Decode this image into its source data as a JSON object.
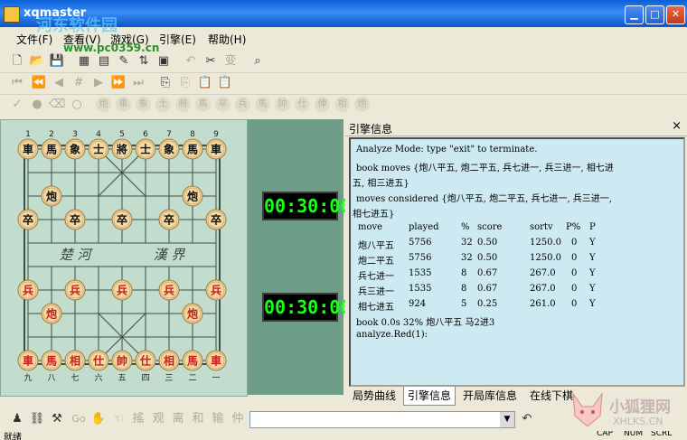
{
  "window": {
    "title": "xqmaster",
    "watermark_top": "河东软件园",
    "watermark_url": "www.pc0359.cn"
  },
  "menu": [
    "文件(F)",
    "查看(V)",
    "游戏(G)",
    "引擎(E)",
    "帮助(H)"
  ],
  "board": {
    "top_numbers": [
      "1",
      "2",
      "3",
      "4",
      "5",
      "6",
      "7",
      "8",
      "9"
    ],
    "bottom_numbers": [
      "九",
      "八",
      "七",
      "六",
      "五",
      "四",
      "三",
      "二",
      "一"
    ],
    "river_left": "楚 河",
    "river_right": "漢 界",
    "pieces": [
      {
        "c": 0,
        "r": 0,
        "t": "車",
        "s": "black"
      },
      {
        "c": 1,
        "r": 0,
        "t": "馬",
        "s": "black"
      },
      {
        "c": 2,
        "r": 0,
        "t": "象",
        "s": "black"
      },
      {
        "c": 3,
        "r": 0,
        "t": "士",
        "s": "black"
      },
      {
        "c": 4,
        "r": 0,
        "t": "將",
        "s": "black"
      },
      {
        "c": 5,
        "r": 0,
        "t": "士",
        "s": "black"
      },
      {
        "c": 6,
        "r": 0,
        "t": "象",
        "s": "black"
      },
      {
        "c": 7,
        "r": 0,
        "t": "馬",
        "s": "black"
      },
      {
        "c": 8,
        "r": 0,
        "t": "車",
        "s": "black"
      },
      {
        "c": 1,
        "r": 2,
        "t": "炮",
        "s": "black"
      },
      {
        "c": 7,
        "r": 2,
        "t": "炮",
        "s": "black"
      },
      {
        "c": 0,
        "r": 3,
        "t": "卒",
        "s": "black"
      },
      {
        "c": 2,
        "r": 3,
        "t": "卒",
        "s": "black"
      },
      {
        "c": 4,
        "r": 3,
        "t": "卒",
        "s": "black"
      },
      {
        "c": 6,
        "r": 3,
        "t": "卒",
        "s": "black"
      },
      {
        "c": 8,
        "r": 3,
        "t": "卒",
        "s": "black"
      },
      {
        "c": 0,
        "r": 6,
        "t": "兵",
        "s": "red"
      },
      {
        "c": 2,
        "r": 6,
        "t": "兵",
        "s": "red"
      },
      {
        "c": 4,
        "r": 6,
        "t": "兵",
        "s": "red"
      },
      {
        "c": 6,
        "r": 6,
        "t": "兵",
        "s": "red"
      },
      {
        "c": 8,
        "r": 6,
        "t": "兵",
        "s": "red"
      },
      {
        "c": 1,
        "r": 7,
        "t": "炮",
        "s": "red"
      },
      {
        "c": 7,
        "r": 7,
        "t": "炮",
        "s": "red"
      },
      {
        "c": 0,
        "r": 9,
        "t": "車",
        "s": "red"
      },
      {
        "c": 1,
        "r": 9,
        "t": "馬",
        "s": "red"
      },
      {
        "c": 2,
        "r": 9,
        "t": "相",
        "s": "red"
      },
      {
        "c": 3,
        "r": 9,
        "t": "仕",
        "s": "red"
      },
      {
        "c": 4,
        "r": 9,
        "t": "帥",
        "s": "red"
      },
      {
        "c": 5,
        "r": 9,
        "t": "仕",
        "s": "red"
      },
      {
        "c": 6,
        "r": 9,
        "t": "相",
        "s": "red"
      },
      {
        "c": 7,
        "r": 9,
        "t": "馬",
        "s": "red"
      },
      {
        "c": 8,
        "r": 9,
        "t": "車",
        "s": "red"
      }
    ]
  },
  "clocks": {
    "top": "00:30:00",
    "bottom": "00:30:00"
  },
  "engine_panel": {
    "title": "引擎信息",
    "close": "×",
    "line1": "Analyze Mode: type \"exit\" to terminate.",
    "line2a": "book moves {炮八平五, 炮二平五, 兵七进一, 兵三进一, 相七进",
    "line2b": "五, 相三进五}",
    "line3a": "moves considered {炮八平五, 炮二平五, 兵七进一, 兵三进一,",
    "line3b": "相七进五}",
    "headers": [
      "move",
      "played",
      "%",
      "score",
      "sortv",
      "P%",
      "P"
    ],
    "rows": [
      [
        "炮八平五",
        "5756",
        "32",
        "0.50",
        "1250.0",
        "0",
        "Y"
      ],
      [
        "炮二平五",
        "5756",
        "32",
        "0.50",
        "1250.0",
        "0",
        "Y"
      ],
      [
        "兵七进一",
        "1535",
        "8",
        "0.67",
        "267.0",
        "0",
        "Y"
      ],
      [
        "兵三进一",
        "1535",
        "8",
        "0.67",
        "267.0",
        "0",
        "Y"
      ],
      [
        "相七进五",
        "924",
        "5",
        "0.25",
        "261.0",
        "0",
        "Y"
      ]
    ],
    "book_line": "book   0.0s      32%      炮八平五 马2进3",
    "last_line": "analyze.Red(1):",
    "tabs": [
      "局势曲线",
      "引擎信息",
      "开局库信息",
      "在线下棋"
    ]
  },
  "bottom_tools": [
    "搖",
    "观",
    "离",
    "和",
    "输",
    "仲"
  ],
  "bottom_go": "Go",
  "status": {
    "left": "就绪",
    "right1": "CAP",
    "right2": "NUM",
    "right3": "SCRL"
  },
  "logo": {
    "line1": "小狐狸网",
    "line2": "XHLKS.CN"
  }
}
